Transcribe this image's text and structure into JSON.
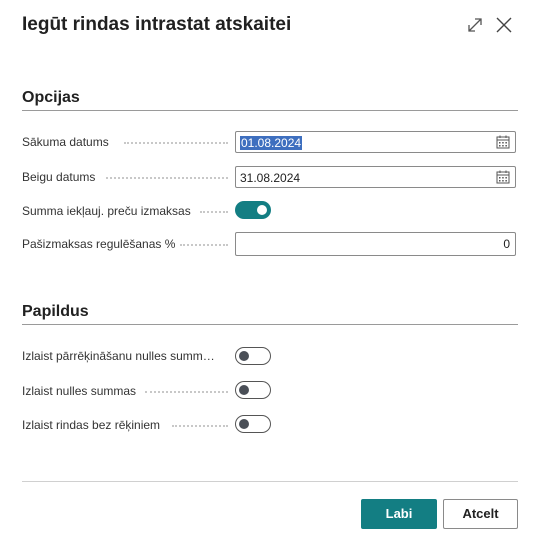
{
  "dialog": {
    "title": "Iegūt rindas intrastat atskaitei"
  },
  "header_icons": {
    "expand": "expand-icon",
    "close": "close-icon"
  },
  "sections": {
    "options": {
      "title": "Opcijas",
      "start_date": {
        "label": "Sākuma datums",
        "value": "01.08.2024"
      },
      "end_date": {
        "label": "Beigu datums",
        "value": "31.08.2024"
      },
      "include_item_charges": {
        "label": "Summa iekļauj. preču izmaksas",
        "on": true
      },
      "cost_regulation": {
        "label": "Pašizmaksas regulēšanas %",
        "value": "0"
      }
    },
    "additional": {
      "title": "Papildus",
      "skip_recalc_zero": {
        "label": "Izlaist pārrēķināšanu nulles summ…",
        "on": false
      },
      "skip_zero_amounts": {
        "label": "Izlaist nulles summas",
        "on": false
      },
      "skip_no_invoices": {
        "label": "Izlaist rindas bez rēķiniem",
        "on": false
      }
    }
  },
  "footer": {
    "ok_label": "Labi",
    "cancel_label": "Atcelt"
  },
  "colors": {
    "accent": "#137e83",
    "selection": "#3e6fbf"
  }
}
